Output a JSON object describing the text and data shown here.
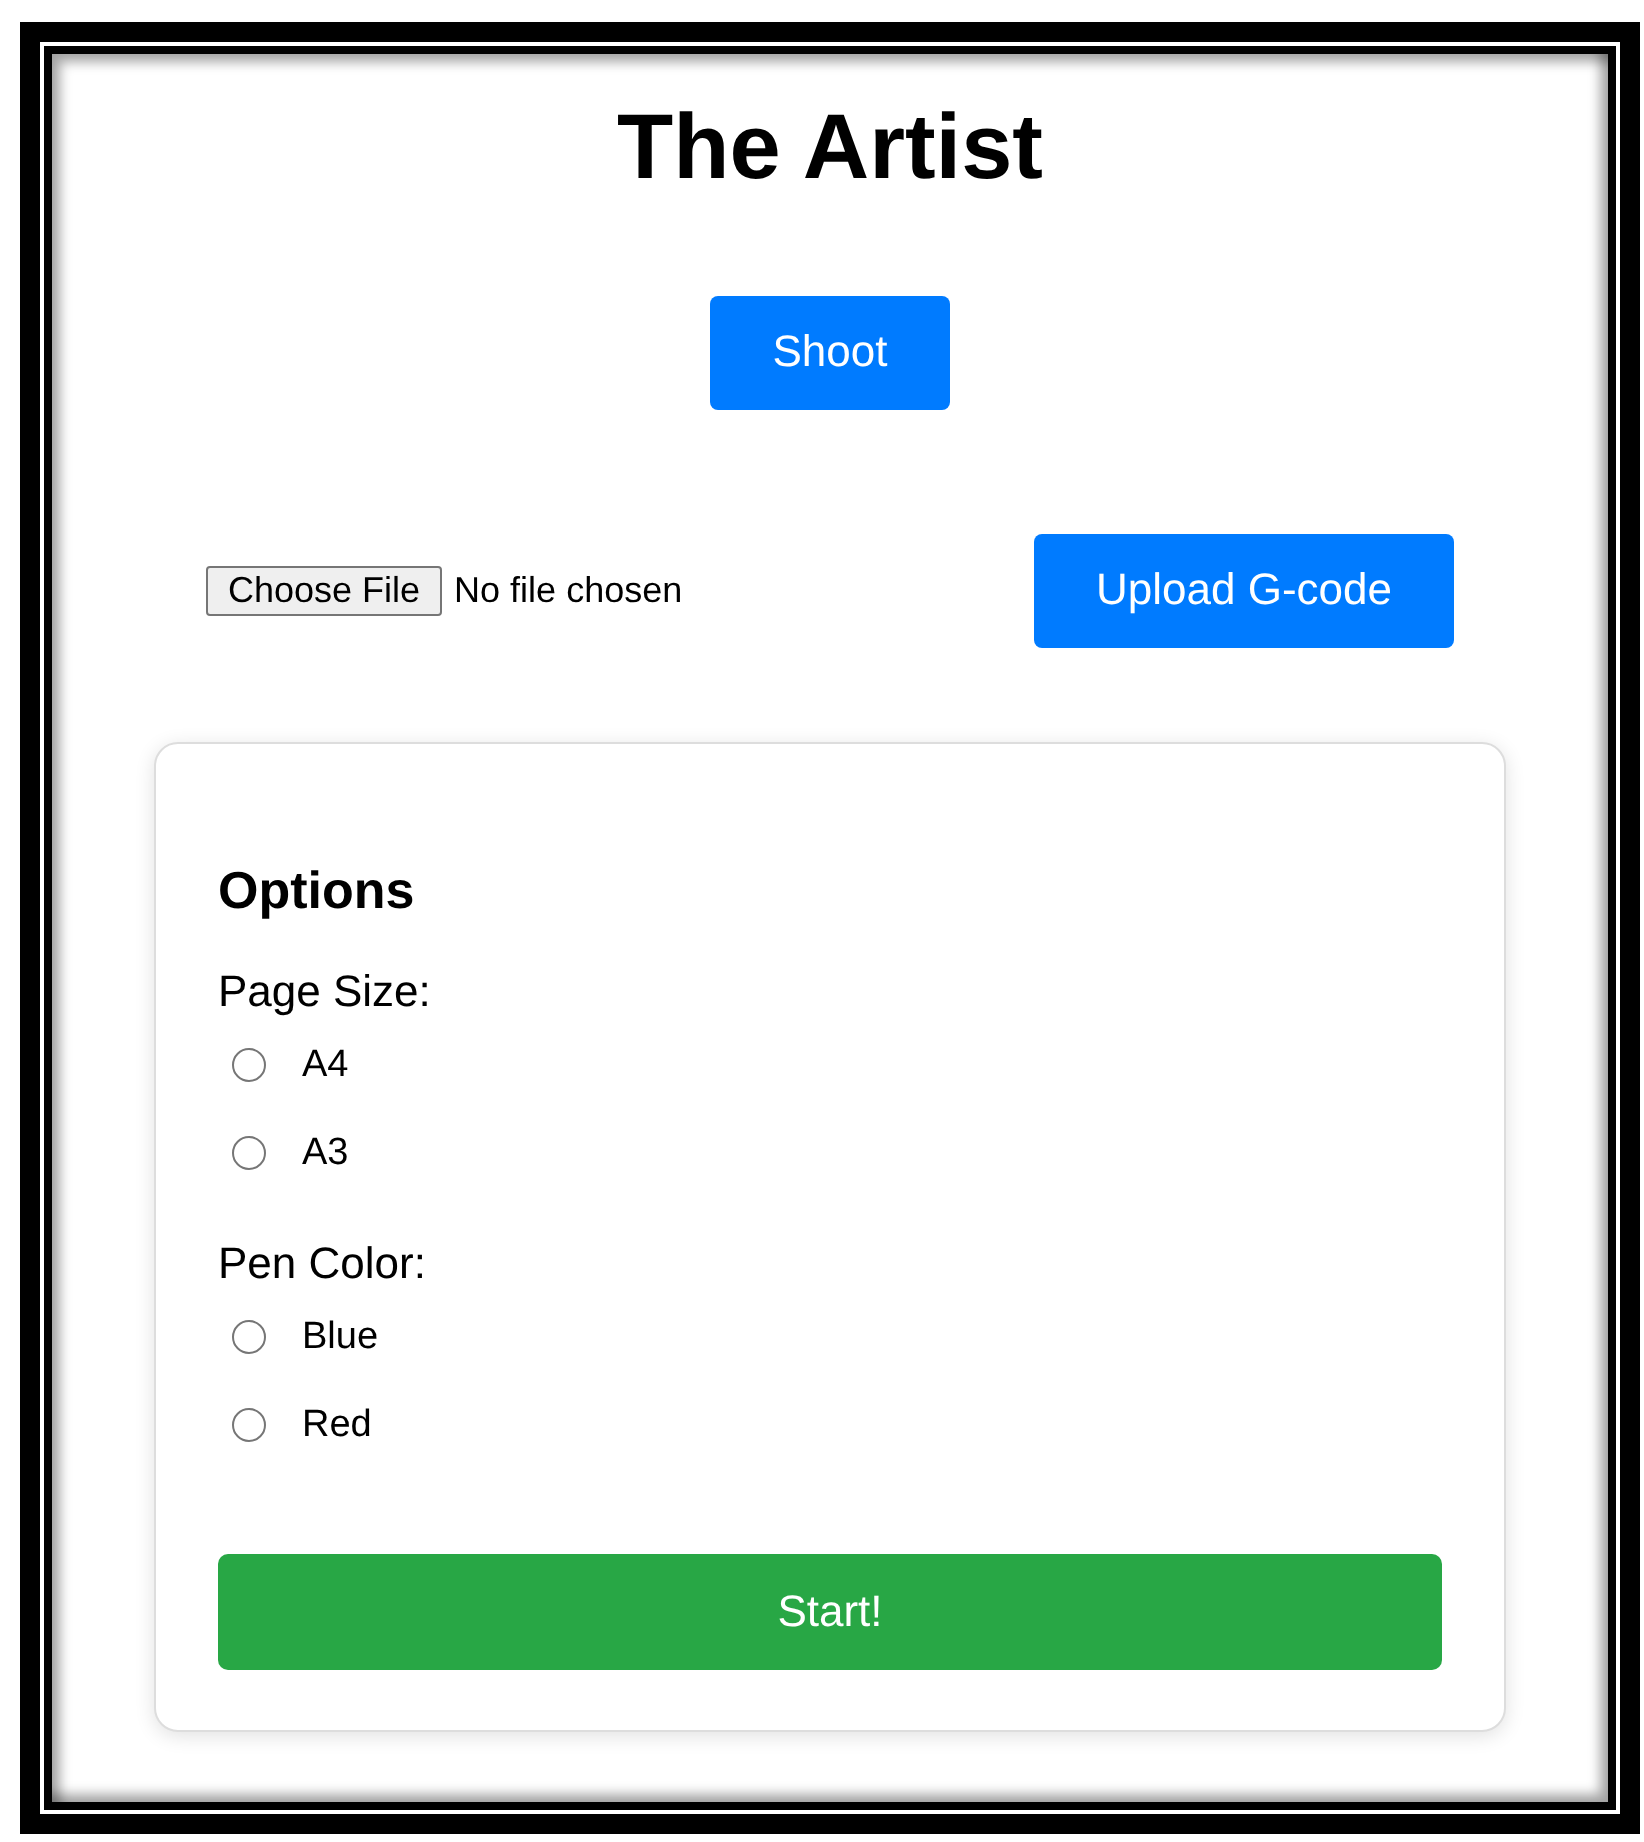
{
  "title": "The Artist",
  "shoot_button": "Shoot",
  "file_input": {
    "button": "Choose File",
    "status": "No file chosen"
  },
  "upload_button": "Upload G-code",
  "options": {
    "heading": "Options",
    "groups": [
      {
        "label": "Page Size:",
        "choices": [
          {
            "label": "A4",
            "selected": false
          },
          {
            "label": "A3",
            "selected": false
          }
        ]
      },
      {
        "label": "Pen Color:",
        "choices": [
          {
            "label": "Blue",
            "selected": false
          },
          {
            "label": "Red",
            "selected": false
          }
        ]
      }
    ]
  },
  "start_button": "Start!"
}
